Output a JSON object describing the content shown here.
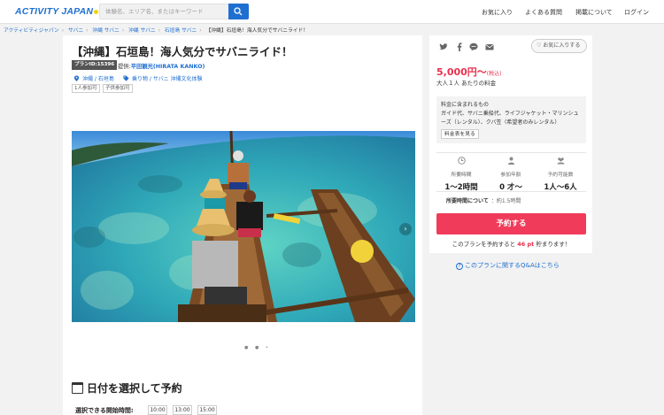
{
  "header": {
    "logo": "ACTIVITY JAPAN",
    "search_placeholder": "体験名、エリア名、またはキーワード",
    "nav": [
      "お気に入り",
      "よくある質問",
      "掲載について",
      "ログイン"
    ]
  },
  "breadcrumb": [
    "アクティビティジャパン",
    "サバニ",
    "沖縄 サバニ",
    "沖縄 サバニ",
    "石垣島 サバニ",
    "【沖縄】石垣島！海人気分でサバニライド！"
  ],
  "plan": {
    "title": "【沖縄】石垣島！海人気分でサバニライド！",
    "plan_id": "プランID:15396",
    "provider_label": "提供:",
    "provider_name": "平田観光(HIRATA KANKO)",
    "location": "沖縄 / 石垣島",
    "category": "乗り物 / サバニ 沖縄文化体験",
    "tags": [
      "1人参加可",
      "子供参加可"
    ]
  },
  "calendar": {
    "title": "日付を選択して予約",
    "time_label": "選択できる開始時間:",
    "times": [
      "10:00",
      "13:00",
      "15:00"
    ]
  },
  "sidebar": {
    "favorite_label": "お気に入りする",
    "price": "5,000円〜",
    "price_tax": "(税込)",
    "price_unit": "大人１人 あたりの料金",
    "included_title": "料金に含まれるもの",
    "included_text": "ガイド代、サバニ乗船代、ライフジャケット・マリンシューズ（レンタル）、クバ笠（希望者のみレンタル）",
    "fee_table_button": "料金表を見る",
    "stats": [
      {
        "label": "所要時間",
        "value": "1〜2時間",
        "icon": "clock-icon"
      },
      {
        "label": "参加年齢",
        "value": "0 才〜",
        "icon": "person-icon"
      },
      {
        "label": "予約可能数",
        "value": "1人〜6人",
        "icon": "group-icon"
      }
    ],
    "duration_label": "所要時間について",
    "duration_value": "：約1.5時間",
    "reserve_button": "予約する",
    "points_prefix": "このプランを予約すると",
    "points_value": "46 pt",
    "points_suffix": "貯まります！"
  },
  "qa_link": "このプランに関するQ&Aはこちら",
  "colors": {
    "brand_blue": "#1f6fd1",
    "accent_red": "#f03c5a"
  }
}
